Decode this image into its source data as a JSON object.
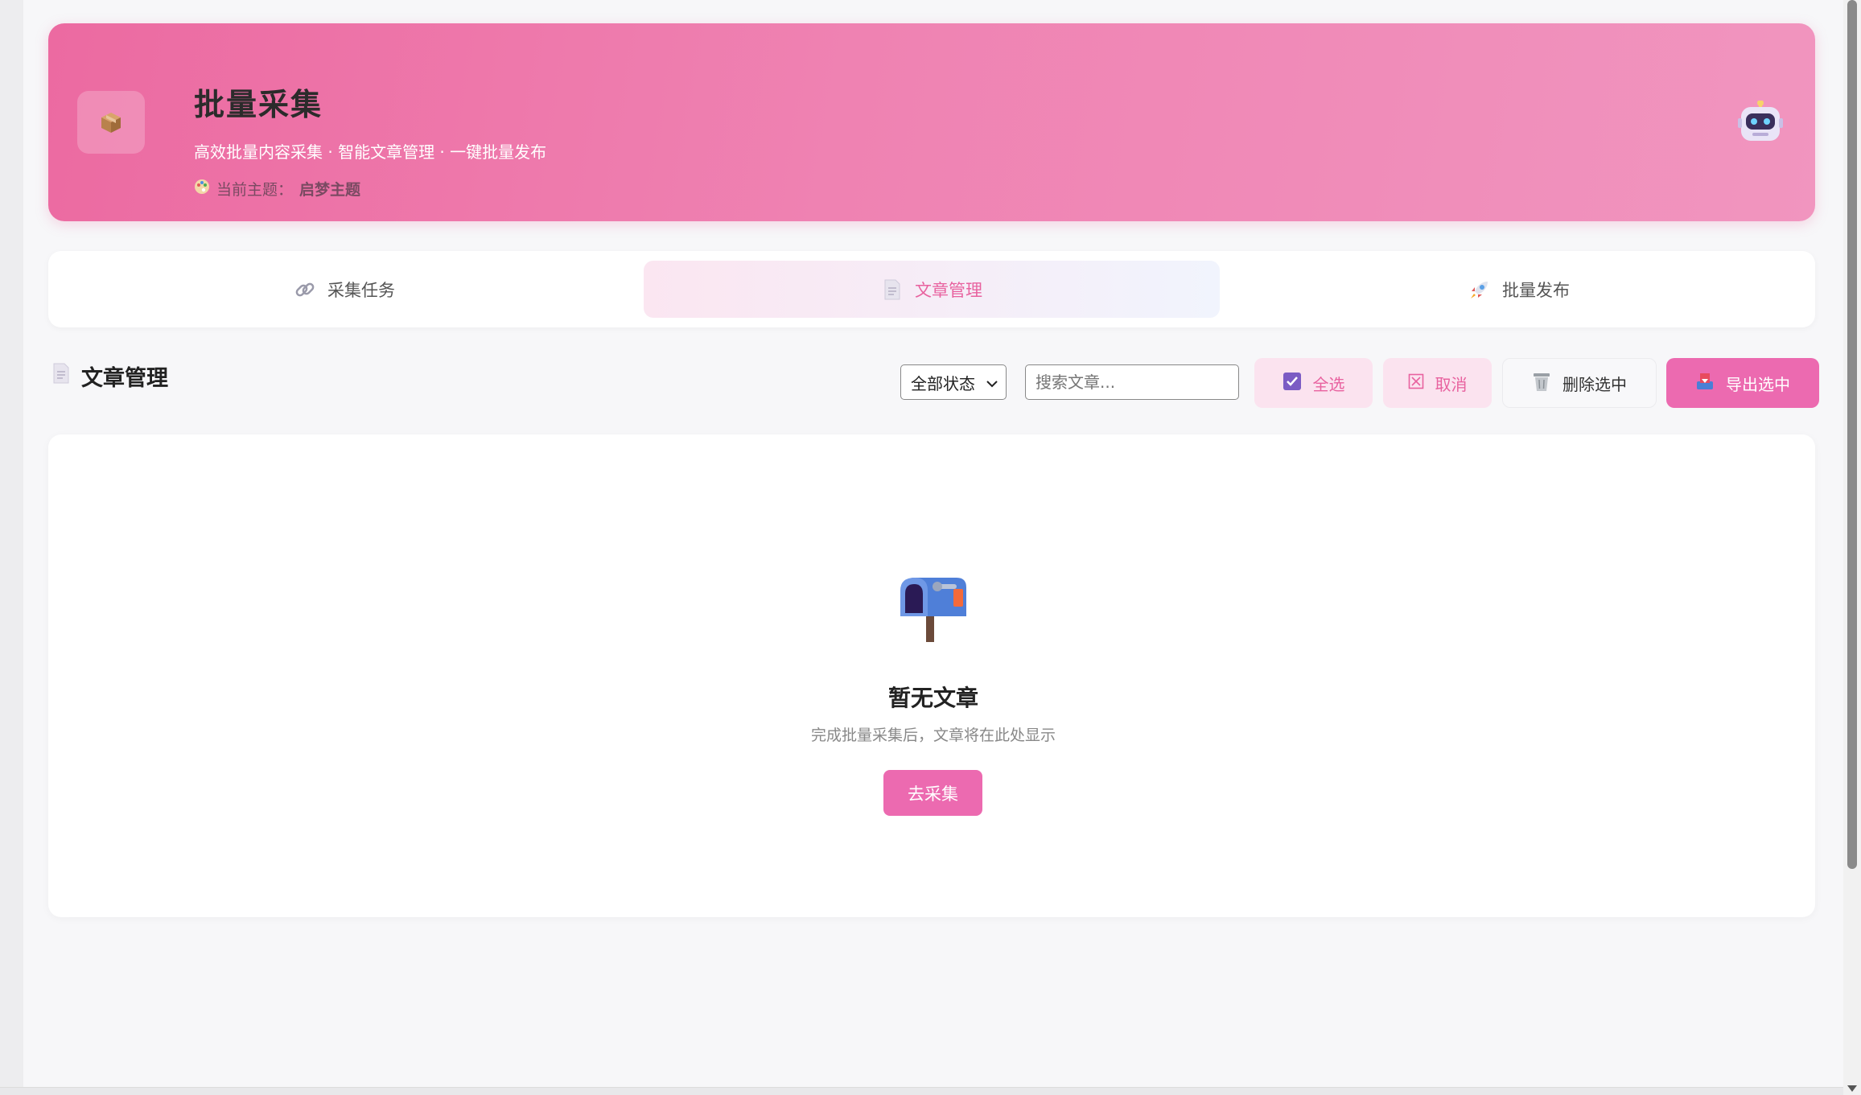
{
  "hero": {
    "title": "批量采集",
    "subtitle": "高效批量内容采集 · 智能文章管理 · 一键批量发布",
    "theme_label": "当前主题：",
    "theme_value": "启梦主题",
    "logo_icon": "package-icon",
    "avatar_icon": "robot-icon",
    "gradient": [
      "#ec6aa1",
      "#f195bf"
    ]
  },
  "tabs": [
    {
      "label": "采集任务",
      "icon": "link-icon",
      "active": false
    },
    {
      "label": "文章管理",
      "icon": "document-icon",
      "active": true
    },
    {
      "label": "批量发布",
      "icon": "rocket-icon",
      "active": false
    }
  ],
  "section": {
    "title": "文章管理",
    "icon": "document-icon"
  },
  "toolbar": {
    "status_select": "全部状态",
    "search_placeholder": "搜索文章...",
    "select_all": "全选",
    "cancel": "取消",
    "delete_selected": "删除选中",
    "export_selected": "导出选中"
  },
  "empty": {
    "title": "暂无文章",
    "description": "完成批量采集后，文章将在此处显示",
    "button": "去采集",
    "icon": "mailbox-icon"
  },
  "colors": {
    "accent": "#ec6ab0",
    "accent_soft": "#fbe3ef",
    "active_text": "#e8629f"
  }
}
